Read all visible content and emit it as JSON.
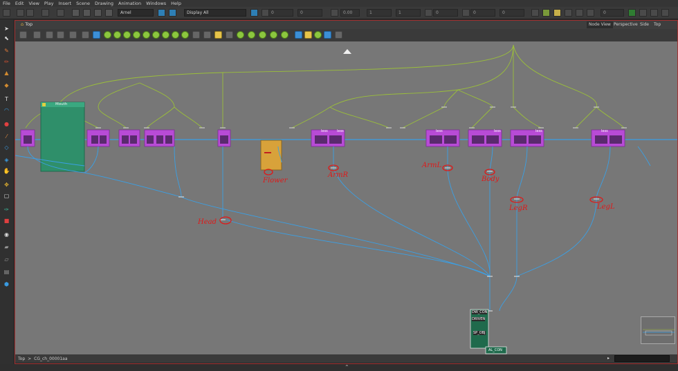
{
  "menu": [
    "File",
    "Edit",
    "View",
    "Play",
    "Insert",
    "Scene",
    "Drawing",
    "Animation",
    "Windows",
    "Help"
  ],
  "toolbar": {
    "element_select": "Arnel",
    "display_select": "Display All",
    "field_value": "0.00",
    "num_fields": [
      "0",
      "0",
      "1",
      "1",
      "0",
      "0",
      "0",
      "0"
    ]
  },
  "view": {
    "breadcrumb_top": "Top",
    "tabs": [
      "Node View",
      "Perspective",
      "Side",
      "Top"
    ],
    "active_tab": "Node View"
  },
  "canvas": {
    "annotations": [
      "Flower",
      "ArmR",
      "ArmL",
      "Body",
      "LegR",
      "LegL",
      "Head"
    ],
    "group_label": "Mouth",
    "composite_labels": [
      "DW_CON",
      "DRIVEN",
      "SP_OBJ",
      "AL_CON"
    ],
    "node_label": "less",
    "colors": {
      "wire_blue": "#3aa0e6",
      "wire_green": "#9bbf3a",
      "node_purple": "#b84bd6",
      "mouth_green": "#2f8f6a",
      "flower_orange": "#d8a23a",
      "annotation_red": "#e01818"
    }
  },
  "status": {
    "crumb_root": "Top",
    "crumb_sep": ">",
    "crumb_child": "CG_ch_00001aa"
  }
}
